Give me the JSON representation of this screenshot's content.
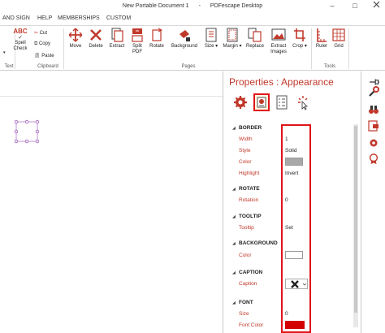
{
  "titlebar": {
    "doc_title": "New Portable Document 1",
    "separator": "-",
    "app_name": "PDFescape Desktop",
    "minimize": "–",
    "restore": "□"
  },
  "menu": [
    "AND SIGN",
    "HELP",
    "MEMBERSHIPS",
    "CUSTOM"
  ],
  "ribbon": {
    "text_group_label": "Text",
    "spell_check_icon_text": "ABC",
    "spell_check": "Spell Check",
    "clipboard": {
      "cut": "Cut",
      "copy": "Copy",
      "paste": "Paste",
      "label": "Clipboard"
    },
    "pages_buttons": [
      "Move",
      "Delete",
      "Extract",
      "Split PDF",
      "Rotate",
      "Background",
      "Size",
      "Margin",
      "Replace",
      "Extract Images",
      "Crop"
    ],
    "pages_label": "Pages",
    "tools_buttons": [
      "Ruler",
      "Grid"
    ],
    "tools_label": "Tools"
  },
  "props": {
    "title": "Properties : Appearance",
    "sections": [
      {
        "name": "BORDER",
        "rows": [
          {
            "label": "Width",
            "value": "1"
          },
          {
            "label": "Style",
            "value": "Solid"
          },
          {
            "label": "Color",
            "value": ""
          },
          {
            "label": "Highlight",
            "value": "Invert"
          }
        ]
      },
      {
        "name": "ROTATE",
        "rows": [
          {
            "label": "Rotation",
            "value": "0"
          }
        ]
      },
      {
        "name": "TOOLTIP",
        "rows": [
          {
            "label": "Tooltip",
            "value": "Set"
          }
        ]
      },
      {
        "name": "BACKGROUND",
        "rows": [
          {
            "label": "Color",
            "value": ""
          }
        ]
      },
      {
        "name": "CAPTION",
        "rows": [
          {
            "label": "Caption",
            "value": ""
          }
        ]
      },
      {
        "name": "FONT",
        "rows": [
          {
            "label": "Size",
            "value": "0"
          },
          {
            "label": "Font Color",
            "value": ""
          }
        ]
      }
    ],
    "border_color_swatch": "#a8a8a8",
    "background_color_swatch": "#ffffff",
    "font_color_swatch": "#d40000",
    "highlight_color": "#e0151a"
  },
  "colors": {
    "accent": "#c0392b",
    "selection": "#9b59b6"
  }
}
